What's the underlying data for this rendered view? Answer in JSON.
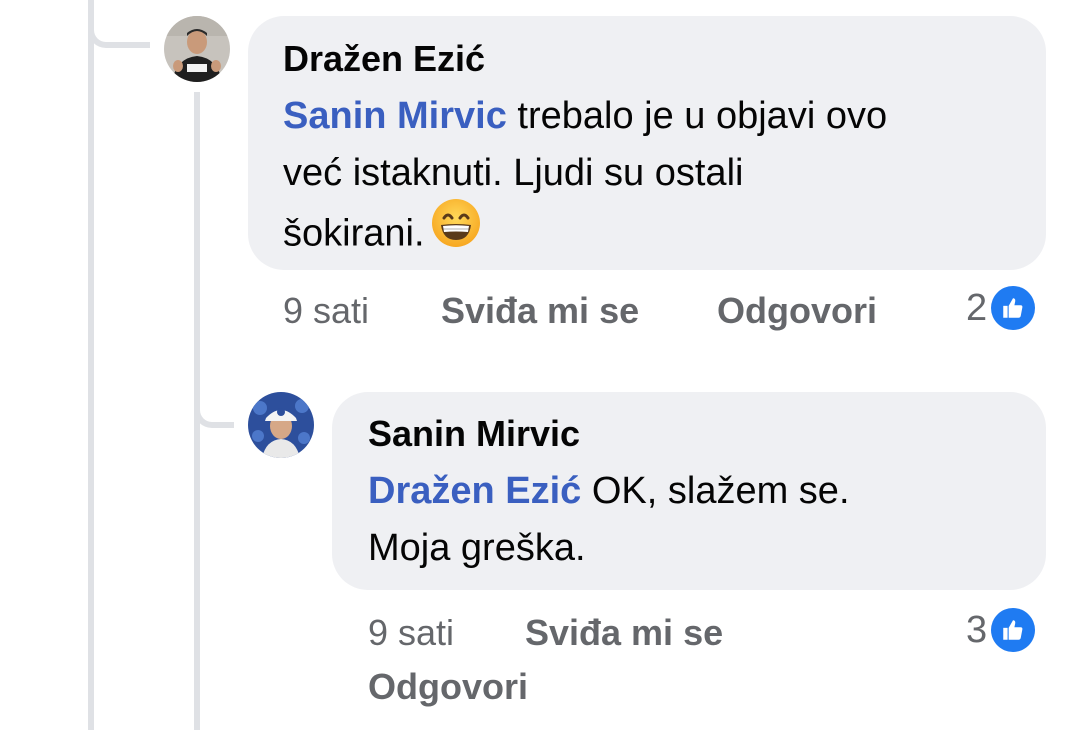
{
  "comment": {
    "author": "Dražen Ezić",
    "mention": "Sanin Mirvic",
    "line1_rest": " trebalo je u objavi ovo",
    "line2": "već istaknuti. Ljudi su ostali",
    "line3": "šokirani.",
    "emoji": "grinning-face-with-smiling-eyes",
    "time": "9 sati",
    "like_label": "Sviđa mi se",
    "reply_label": "Odgovori",
    "reaction_count": "2"
  },
  "reply": {
    "author": "Sanin Mirvic",
    "mention": "Dražen Ezić",
    "line1_rest": " OK, slažem se.",
    "line2": "Moja greška.",
    "time": "9 sati",
    "like_label": "Sviđa mi se",
    "reply_label": "Odgovori",
    "reaction_count": "3"
  },
  "colors": {
    "mention": "#3a5fc0",
    "bubble": "#eff0f3",
    "meta": "#65676b",
    "like": "#1f7bf2",
    "thread_line": "#dfe1e5"
  }
}
